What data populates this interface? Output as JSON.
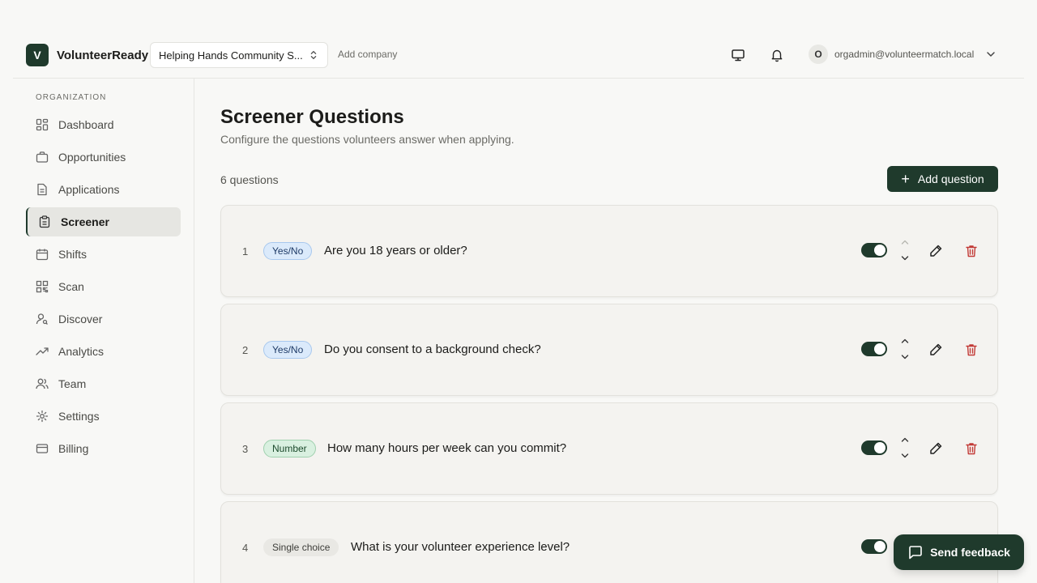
{
  "brand": {
    "logo_letter": "V",
    "name": "VolunteerReady"
  },
  "header": {
    "company": "Helping Hands Community S...",
    "add_company": "Add company",
    "user_initial": "O",
    "user_email": "orgadmin@volunteermatch.local"
  },
  "sidebar": {
    "heading": "ORGANIZATION",
    "items": [
      {
        "label": "Dashboard",
        "icon": "dashboard-icon"
      },
      {
        "label": "Opportunities",
        "icon": "briefcase-icon"
      },
      {
        "label": "Applications",
        "icon": "document-icon"
      },
      {
        "label": "Screener",
        "icon": "clipboard-icon",
        "active": true
      },
      {
        "label": "Shifts",
        "icon": "calendar-icon"
      },
      {
        "label": "Scan",
        "icon": "qr-code-icon"
      },
      {
        "label": "Discover",
        "icon": "user-search-icon"
      },
      {
        "label": "Analytics",
        "icon": "trending-up-icon"
      },
      {
        "label": "Team",
        "icon": "users-icon"
      },
      {
        "label": "Settings",
        "icon": "gear-icon"
      },
      {
        "label": "Billing",
        "icon": "credit-card-icon"
      }
    ]
  },
  "main": {
    "title": "Screener Questions",
    "subtitle": "Configure the questions volunteers answer when applying.",
    "count": "6 questions",
    "add_button": "Add question",
    "questions": [
      {
        "num": "1",
        "type": "Yes/No",
        "text": "Are you 18 years or older?",
        "enabled": true
      },
      {
        "num": "2",
        "type": "Yes/No",
        "text": "Do you consent to a background check?",
        "enabled": true
      },
      {
        "num": "3",
        "type": "Number",
        "text": "How many hours per week can you commit?",
        "enabled": true
      },
      {
        "num": "4",
        "type": "Single choice",
        "text": "What is your volunteer experience level?",
        "enabled": true
      }
    ]
  },
  "feedback": {
    "label": "Send feedback"
  }
}
